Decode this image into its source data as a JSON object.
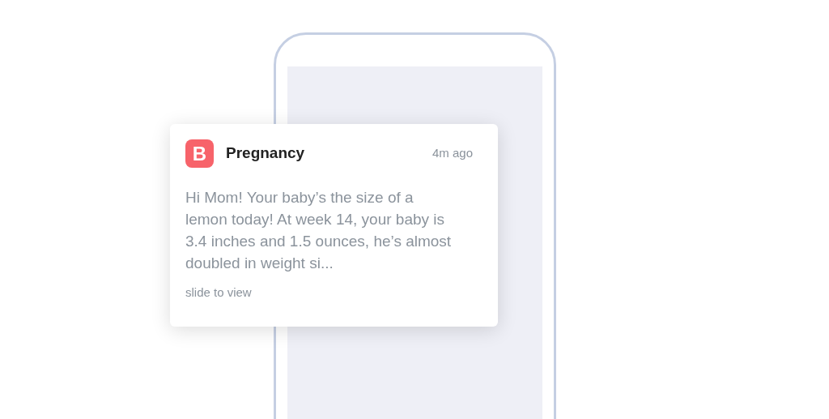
{
  "notification": {
    "app_logo": "B",
    "app_name": "Pregnancy",
    "time": "4m ago",
    "message": "Hi Mom! Your baby’s the size of a lemon today! At week 14, your baby is 3.4 inches and 1.5 ounces, he’s almost doubled in weight si...",
    "action_hint": "slide to view"
  }
}
